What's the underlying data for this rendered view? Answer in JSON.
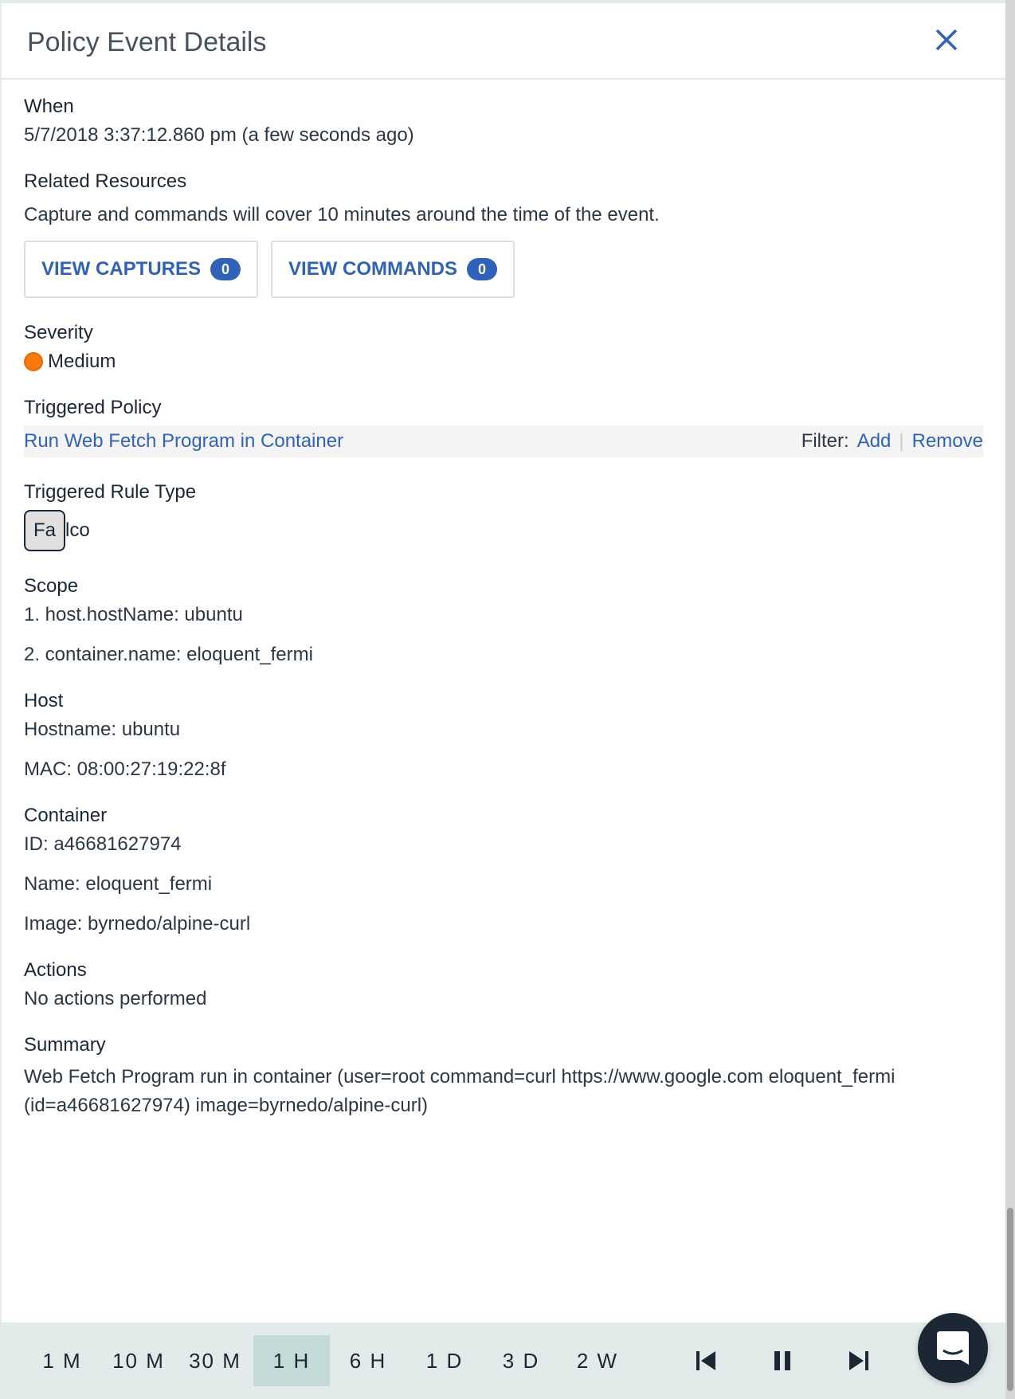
{
  "header": {
    "title": "Policy Event Details",
    "close_icon": "close-icon"
  },
  "when": {
    "label": "When",
    "value": "5/7/2018 3:37:12.860 pm (a few seconds ago)"
  },
  "related": {
    "label": "Related Resources",
    "description": "Capture and commands will cover 10 minutes around the time of the event.",
    "captures_label": "VIEW CAPTURES",
    "captures_count": "0",
    "commands_label": "VIEW COMMANDS",
    "commands_count": "0"
  },
  "severity": {
    "label": "Severity",
    "value": "Medium",
    "color": "#f97a0a"
  },
  "policy": {
    "label": "Triggered Policy",
    "name": "Run Web Fetch Program in Container",
    "filter_label": "Filter:",
    "add_label": "Add",
    "sep": "|",
    "remove_label": "Remove"
  },
  "rule_type": {
    "label": "Triggered Rule Type",
    "abbr": "Fa",
    "rest": "lco"
  },
  "scope": {
    "label": "Scope",
    "items": [
      "1. host.hostName: ubuntu",
      "2. container.name: eloquent_fermi"
    ]
  },
  "host": {
    "label": "Host",
    "hostname": "Hostname: ubuntu",
    "mac": "MAC: 08:00:27:19:22:8f"
  },
  "container": {
    "label": "Container",
    "id": "ID: a46681627974",
    "name": "Name: eloquent_fermi",
    "image": "Image: byrnedo/alpine-curl"
  },
  "actions": {
    "label": "Actions",
    "value": "No actions performed"
  },
  "summary": {
    "label": "Summary",
    "value": "Web Fetch Program run in container (user=root command=curl https://www.google.com eloquent_fermi (id=a46681627974) image=byrnedo/alpine-curl)"
  },
  "timebar": {
    "ranges": [
      "1 M",
      "10 M",
      "30 M",
      "1 H",
      "6 H",
      "1 D",
      "3 D",
      "2 W"
    ],
    "active": "1 H",
    "controls": [
      "skip-back-icon",
      "pause-icon",
      "skip-forward-icon"
    ]
  },
  "chat": {
    "icon": "chat-icon"
  },
  "colors": {
    "accent": "#2f62b8",
    "bar_bg": "#e3ebea",
    "active_range": "#c4dad9"
  }
}
